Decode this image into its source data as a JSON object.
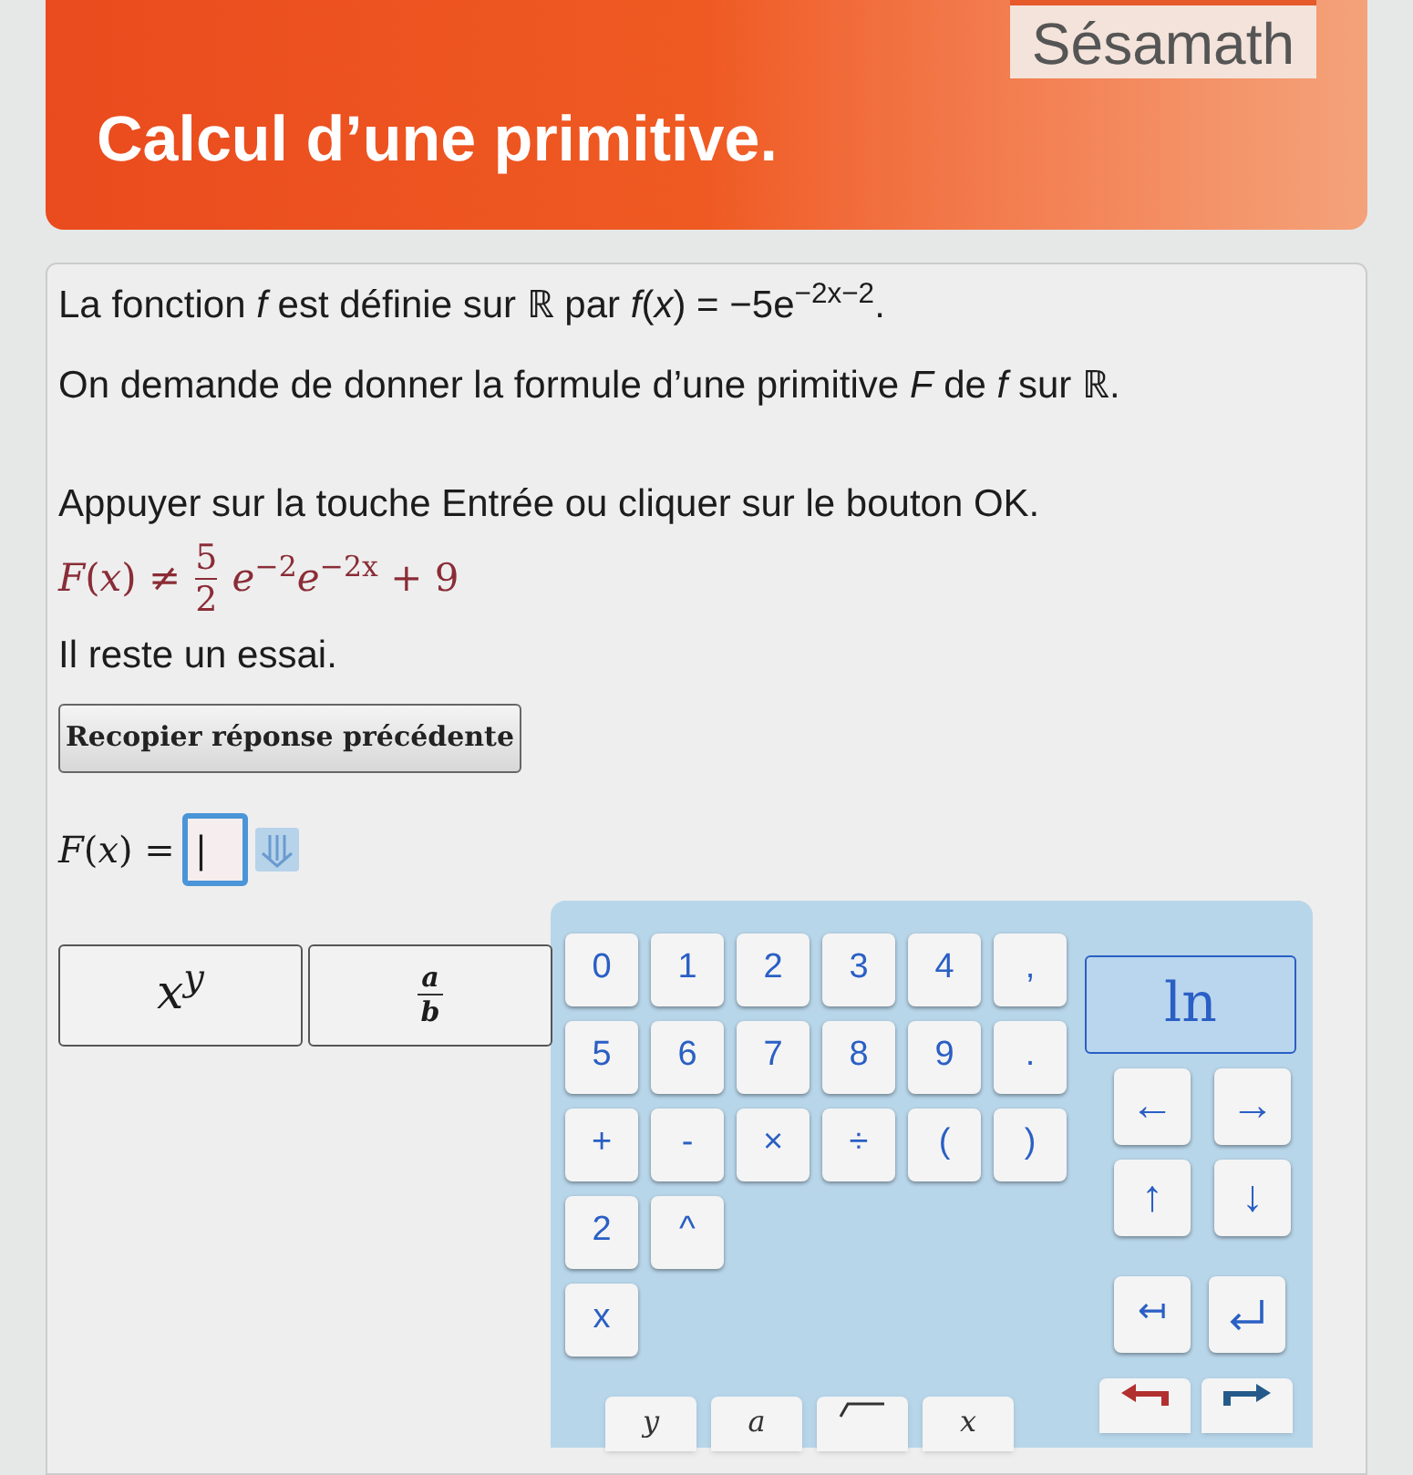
{
  "header": {
    "title": "Calcul d’une primitive.",
    "logo": "Sésamath"
  },
  "paragraphs": [
    "La fonction *f* est définie sur ℝ par *f*(*x*) = −5e$^{−2x−2}$.",
    "On demande de donner la formule d’une primitive *F* de *f* sur ℝ.",
    "Appuyer sur la touche Entrée ou cliquer sur le bouton OK."
  ],
  "previous_answer": {
    "lhs": "*F*(*x*) ≠",
    "numerator": "5",
    "denominator": "2",
    "rest": "*e*$^{−2}$*e*$^{−2x}$ + 9"
  },
  "remaining": "Il reste un essai.",
  "copy_button": "Recopier réponse précédente",
  "answer": {
    "label": "*F*(*x*) =",
    "value": "|"
  },
  "template_buttons": [
    {
      "kind": "power",
      "base": "x",
      "exponent": "y"
    },
    {
      "kind": "fraction",
      "numerator": "a",
      "denominator": "b"
    }
  ],
  "keypad": {
    "rows": [
      [
        "0",
        "1",
        "2",
        "3",
        "4",
        ","
      ],
      [
        "5",
        "6",
        "7",
        "8",
        "9",
        "."
      ],
      [
        "+",
        "-",
        "×",
        "÷",
        "(",
        ")"
      ],
      [
        "2",
        "^"
      ],
      [
        "x"
      ]
    ],
    "function_key": "ln",
    "arrow_keys": [
      "←",
      "→",
      "↑",
      "↓"
    ],
    "edit_keys": [
      {
        "kind": "text",
        "label": "↤"
      },
      {
        "kind": "enter"
      }
    ],
    "bottom_keys": [
      {
        "kind": "text",
        "label": "y"
      },
      {
        "kind": "text",
        "label": "a"
      },
      {
        "kind": "root"
      },
      {
        "kind": "text",
        "label": "x"
      },
      {
        "kind": "undo"
      },
      {
        "kind": "redo"
      }
    ]
  }
}
